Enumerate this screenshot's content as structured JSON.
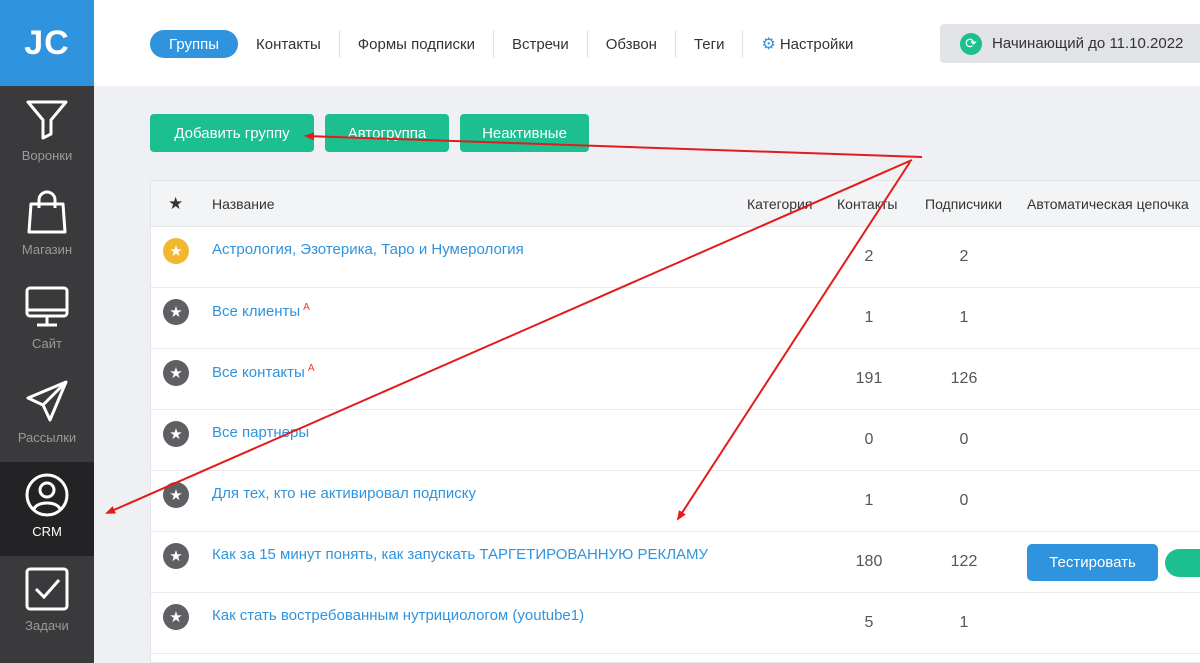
{
  "logo": "JC",
  "sidebar": {
    "items": [
      {
        "label": "Воронки",
        "icon": "funnel-icon"
      },
      {
        "label": "Магазин",
        "icon": "shopping-bag-icon"
      },
      {
        "label": "Сайт",
        "icon": "monitor-icon"
      },
      {
        "label": "Рассылки",
        "icon": "paper-plane-icon"
      },
      {
        "label": "CRM",
        "icon": "user-circle-icon",
        "active": true
      },
      {
        "label": "Задачи",
        "icon": "checkbox-icon"
      }
    ]
  },
  "tabs": [
    {
      "label": "Группы",
      "active": true
    },
    {
      "label": "Контакты"
    },
    {
      "label": "Формы подписки"
    },
    {
      "label": "Встречи"
    },
    {
      "label": "Обзвон"
    },
    {
      "label": "Теги"
    },
    {
      "label": "Настройки",
      "icon": "gear-icon"
    }
  ],
  "plan": {
    "label": "Начинающий до 11.10.2022",
    "icon": "refresh-icon"
  },
  "actions": {
    "add_group": "Добавить группу",
    "autogroup": "Автогруппа",
    "inactive": "Неактивные"
  },
  "table": {
    "headers": {
      "name": "Название",
      "category": "Категория",
      "contacts": "Контакты",
      "subscribers": "Подписчики",
      "chain": "Автоматическая цепочка"
    },
    "rows": [
      {
        "name": "Астрология, Эзотерика, Таро и Нумерология",
        "mark": "",
        "contacts": "2",
        "subscribers": "2",
        "starred": true
      },
      {
        "name": "Все клиенты",
        "mark": "А",
        "contacts": "1",
        "subscribers": "1"
      },
      {
        "name": "Все контакты",
        "mark": "А",
        "contacts": "191",
        "subscribers": "126"
      },
      {
        "name": "Все партнеры",
        "mark": "",
        "contacts": "0",
        "subscribers": "0"
      },
      {
        "name": "Для тех, кто не активировал подписку",
        "mark": "",
        "contacts": "1",
        "subscribers": "0"
      },
      {
        "name": "Как за 15 минут понять, как запускать ТАРГЕТИРОВАННУЮ РЕКЛАМУ",
        "mark": "",
        "contacts": "180",
        "subscribers": "122",
        "test_label": "Тестировать"
      },
      {
        "name": "Как стать востребованным нутрициологом (youtube1)",
        "mark": "",
        "contacts": "5",
        "subscribers": "1"
      }
    ]
  },
  "colors": {
    "accent_blue": "#2f94dd",
    "accent_green": "#1cbf8f",
    "sidebar_bg": "#3a3a3c",
    "annotation_red": "#e31b1b"
  }
}
